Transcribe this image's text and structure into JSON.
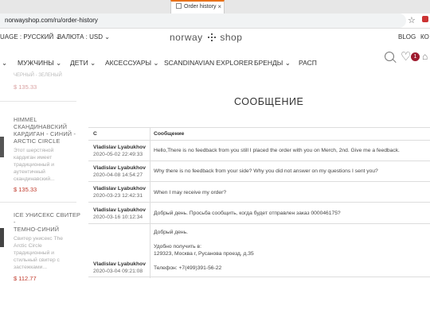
{
  "browser": {
    "tab_title": "Order history",
    "tab_close": "×",
    "url": "norwayshop.com/ru/order-history"
  },
  "topbar": {
    "language": "UAGE : РУССКИЙ ⌄",
    "currency": "ВАЛЮТА : USD ⌄",
    "logo_left": "norway",
    "logo_right": "shop",
    "blog": "BLOG",
    "contacts": "КО"
  },
  "nav": {
    "items": [
      "МУЖЧИНЫ ⌄",
      "ДЕТИ ⌄",
      "АКСЕССУАРЫ ⌄",
      "SCANDINAVIAN EXPLORER",
      "БРЕНДЫ ⌄",
      "РАСП"
    ],
    "cart_count": "1"
  },
  "sidebar": {
    "faded_top": "ЧЕРНЫЙ - ЗЕЛЕНЫЙ",
    "faded_price": "$ 135.33",
    "products": [
      {
        "title_lines": [
          "HIMMEL",
          "СКАНДИНАВСКИЙ",
          "КАРДИГАН - СИНИЙ -",
          "ARCTIC CIRCLE"
        ],
        "desc_lines": [
          "Этот шерстяной",
          "кардиган имеет",
          "традиционный и",
          "аутентичный",
          "скандинавский..."
        ],
        "price": "$ 135.33"
      },
      {
        "title_lines": [
          "ICE УНИСЕКС СВИТЕР -",
          "ТЕМНО-СИНИЙ"
        ],
        "desc_lines": [
          "Свитер унисекс The",
          "Arctic Circle",
          "традиционный и",
          "стильный свитер с",
          "застежками..."
        ],
        "price": "$ 112.77"
      }
    ]
  },
  "main": {
    "heading": "СООБЩЕНИЕ",
    "col_sender": "С",
    "col_message": "Сообщение",
    "rows": [
      {
        "sender": "Vladislav Lyabukhov",
        "date": "2020-05-02 22:49:33",
        "message": "Hello,There is no feedback from you still I placed the order with you on Merch, 2nd. Give me a feedback."
      },
      {
        "sender": "Vladislav Lyabukhov",
        "date": "2020-04-08 14:54:27",
        "message": "Why there is no feedback from your side? Why you did not answer on my questions I sent you?"
      },
      {
        "sender": "Vladislav Lyabukhov",
        "date": "2020-03-23 12:42:31",
        "message": "When I may receive my order?"
      },
      {
        "sender": "Vladislav Lyabukhov",
        "date": "2020-03-16 10:12:34",
        "message": "Добрый день. Просьба сообщить, когда будет отправлен заказ 000046175?"
      },
      {
        "sender": "Vladislav Lyabukhov",
        "date": "2020-03-04 09:21:08",
        "message_lines": [
          "Добрый день.",
          "",
          "Удобно получить в:",
          "129323, Москва г, Русанова проезд, д.35",
          "",
          "Телефон: +7(499)391-56-22"
        ]
      }
    ]
  }
}
